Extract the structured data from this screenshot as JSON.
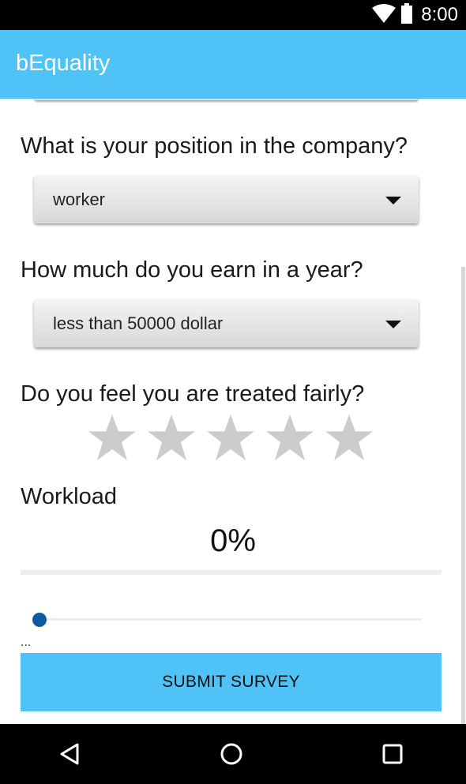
{
  "status_bar": {
    "time": "8:00"
  },
  "app_bar": {
    "title": "bEquality"
  },
  "survey": {
    "position_question": "What is your position in the company?",
    "position_selected": "worker",
    "earnings_question": "How much do you earn in a year?",
    "earnings_selected": "less than 50000 dollar",
    "fairness_question": "Do you feel you are treated fairly?",
    "fairness_rating": 0,
    "fairness_max": 5,
    "workload_label": "Workload",
    "workload_value": "0%",
    "workload_level": 0,
    "ellipsis": "...",
    "submit_label": "SUBMIT SURVEY"
  },
  "colors": {
    "accent": "#4fc3f7",
    "star_empty": "#cccccc",
    "seek_thumb": "#0d5aa1"
  },
  "icons": {
    "status": [
      "wifi-icon",
      "battery-icon"
    ],
    "nav": [
      "back-icon",
      "home-icon",
      "recents-icon"
    ]
  }
}
